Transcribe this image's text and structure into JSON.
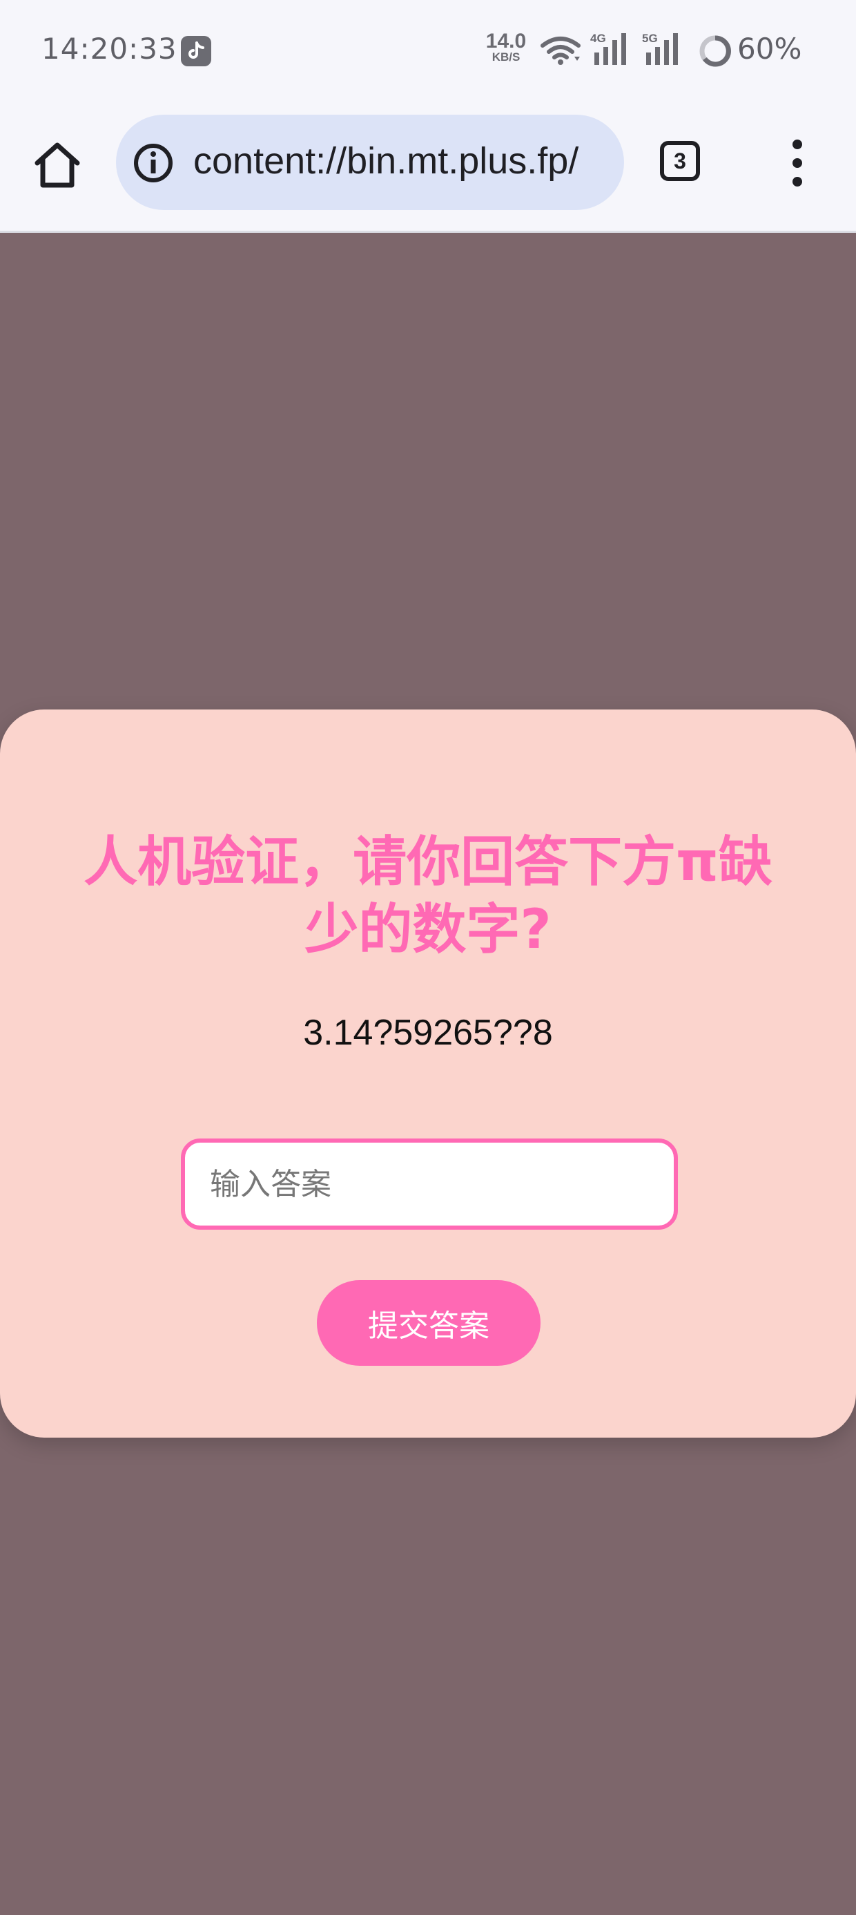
{
  "status_bar": {
    "time": "14:20:33",
    "net_speed": "14.0",
    "net_speed_unit": "KB/S",
    "signal_1_label": "4G",
    "signal_2_label": "5G",
    "battery": "60%"
  },
  "browser": {
    "url": "content://bin.mt.plus.fp/",
    "tab_count": "3"
  },
  "captcha": {
    "title": "人机验证，请你回答下方π缺少的数字?",
    "puzzle": "3.14?59265??8",
    "input_placeholder": "输入答案",
    "input_value": "",
    "submit_label": "提交答案"
  },
  "colors": {
    "page_background": "#7d666b",
    "card_background": "#fbd4cd",
    "accent": "#ff69b4",
    "url_bar": "#dce3f7"
  }
}
